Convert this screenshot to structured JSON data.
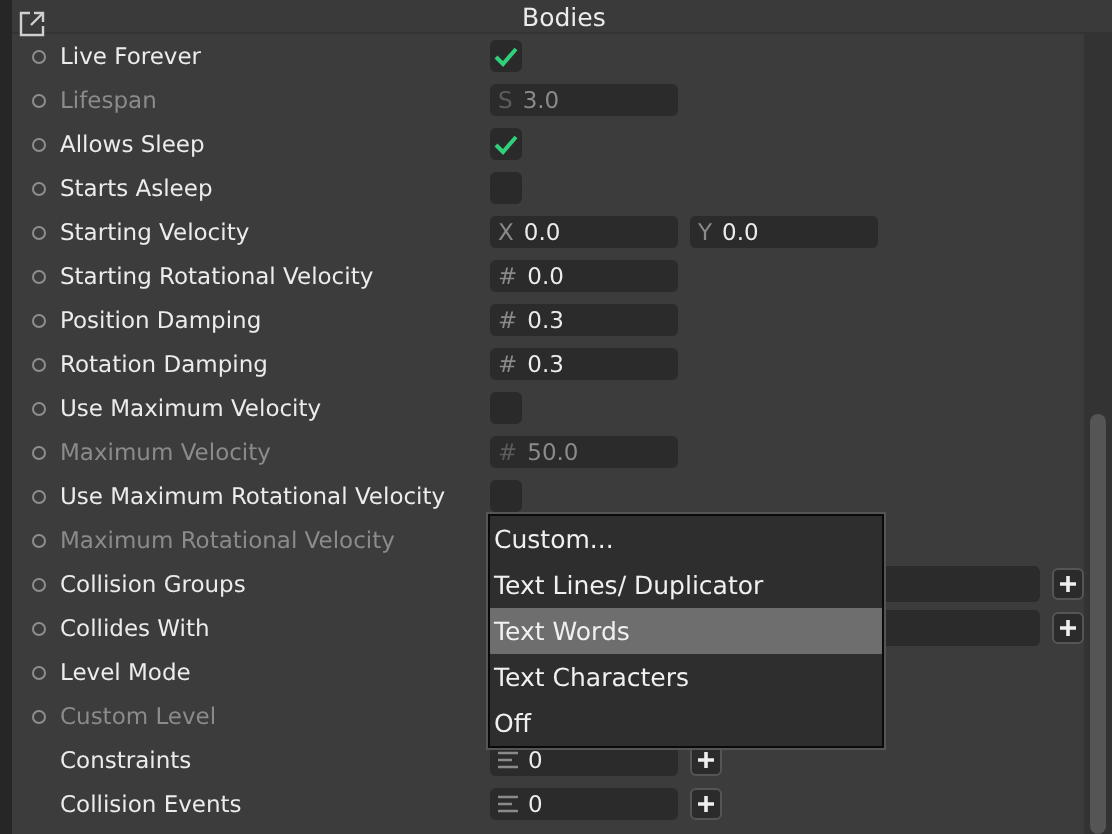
{
  "panel": {
    "title": "Bodies"
  },
  "rows": [
    {
      "label": "Live Forever",
      "dot": true,
      "disabled": false,
      "kind": "checkbox",
      "checked": true
    },
    {
      "label": "Lifespan",
      "dot": true,
      "disabled": true,
      "kind": "number",
      "prefix": "S",
      "value": "3.0"
    },
    {
      "label": "Allows Sleep",
      "dot": true,
      "disabled": false,
      "kind": "checkbox",
      "checked": true
    },
    {
      "label": "Starts Asleep",
      "dot": true,
      "disabled": false,
      "kind": "checkbox",
      "checked": false
    },
    {
      "label": "Starting Velocity",
      "dot": true,
      "disabled": false,
      "kind": "vector",
      "fields": [
        {
          "prefix": "X",
          "value": "0.0"
        },
        {
          "prefix": "Y",
          "value": "0.0"
        }
      ]
    },
    {
      "label": "Starting Rotational Velocity",
      "dot": true,
      "disabled": false,
      "kind": "number",
      "prefix": "#",
      "value": "0.0"
    },
    {
      "label": "Position Damping",
      "dot": true,
      "disabled": false,
      "kind": "number",
      "prefix": "#",
      "value": "0.3"
    },
    {
      "label": "Rotation Damping",
      "dot": true,
      "disabled": false,
      "kind": "number",
      "prefix": "#",
      "value": "0.3"
    },
    {
      "label": "Use Maximum Velocity",
      "dot": true,
      "disabled": false,
      "kind": "checkbox",
      "checked": false
    },
    {
      "label": "Maximum Velocity",
      "dot": true,
      "disabled": true,
      "kind": "number",
      "prefix": "#",
      "value": "50.0"
    },
    {
      "label": "Use Maximum Rotational Velocity",
      "dot": true,
      "disabled": false,
      "kind": "checkbox",
      "checked": false
    },
    {
      "label": "Maximum Rotational Velocity",
      "dot": true,
      "disabled": true,
      "kind": "covered"
    },
    {
      "label": "Collision Groups",
      "dot": true,
      "disabled": false,
      "kind": "tags"
    },
    {
      "label": "Collides With",
      "dot": true,
      "disabled": false,
      "kind": "tags"
    },
    {
      "label": "Level Mode",
      "dot": true,
      "disabled": false,
      "kind": "covered"
    },
    {
      "label": "Custom Level",
      "dot": true,
      "disabled": true,
      "kind": "covered"
    },
    {
      "label": "Constraints",
      "dot": false,
      "disabled": false,
      "kind": "count",
      "value": "0"
    },
    {
      "label": "Collision Events",
      "dot": false,
      "disabled": false,
      "kind": "count",
      "value": "0"
    }
  ],
  "menu": {
    "items": [
      {
        "label": "Custom...",
        "selected": false
      },
      {
        "label": "Text Lines/ Duplicator",
        "selected": false
      },
      {
        "label": "Text Words",
        "selected": true
      },
      {
        "label": "Text Characters",
        "selected": false
      },
      {
        "label": "Off",
        "selected": false
      }
    ]
  }
}
